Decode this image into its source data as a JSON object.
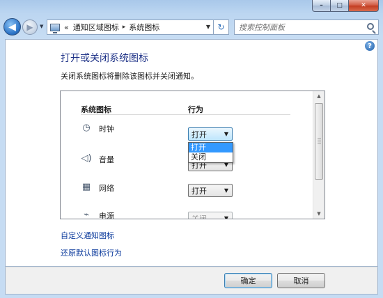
{
  "window": {
    "caption_buttons": {
      "minimize": "–",
      "maximize": "□",
      "close": "✕"
    }
  },
  "addressbar": {
    "back_glyph": "◀",
    "forward_glyph": "▶",
    "recent_glyph": "▼",
    "overflow": "«",
    "breadcrumb": [
      "通知区域图标",
      "系统图标"
    ],
    "separator": "▸",
    "dropdown_glyph": "▼",
    "refresh_glyph": "↻",
    "search_placeholder": "搜索控制面板"
  },
  "page": {
    "help_glyph": "?",
    "title": "打开或关闭系统图标",
    "description": "关闭系统图标将删除该图标并关闭通知。"
  },
  "table": {
    "col_icon": "系统图标",
    "col_behavior": "行为",
    "rows": [
      {
        "icon": "clock-icon",
        "glyph": "◷",
        "label": "时钟",
        "value": "打开",
        "state": "active"
      },
      {
        "icon": "volume-icon",
        "glyph": "◁)",
        "label": "音量",
        "value": "打开",
        "state": "normal"
      },
      {
        "icon": "network-icon",
        "glyph": "▦",
        "label": "网络",
        "value": "打开",
        "state": "normal"
      },
      {
        "icon": "power-icon",
        "glyph": "⌁",
        "label": "电源",
        "value": "关闭",
        "state": "disabled"
      }
    ],
    "dropdown_options": [
      "打开",
      "关闭"
    ],
    "dropdown_selected": "打开",
    "combo_arrow": "▼"
  },
  "scrollbar": {
    "up": "▲",
    "down": "▼"
  },
  "links": {
    "customize": "自定义通知图标",
    "restore": "还原默认图标行为"
  },
  "buttons": {
    "ok": "确定",
    "cancel": "取消"
  }
}
